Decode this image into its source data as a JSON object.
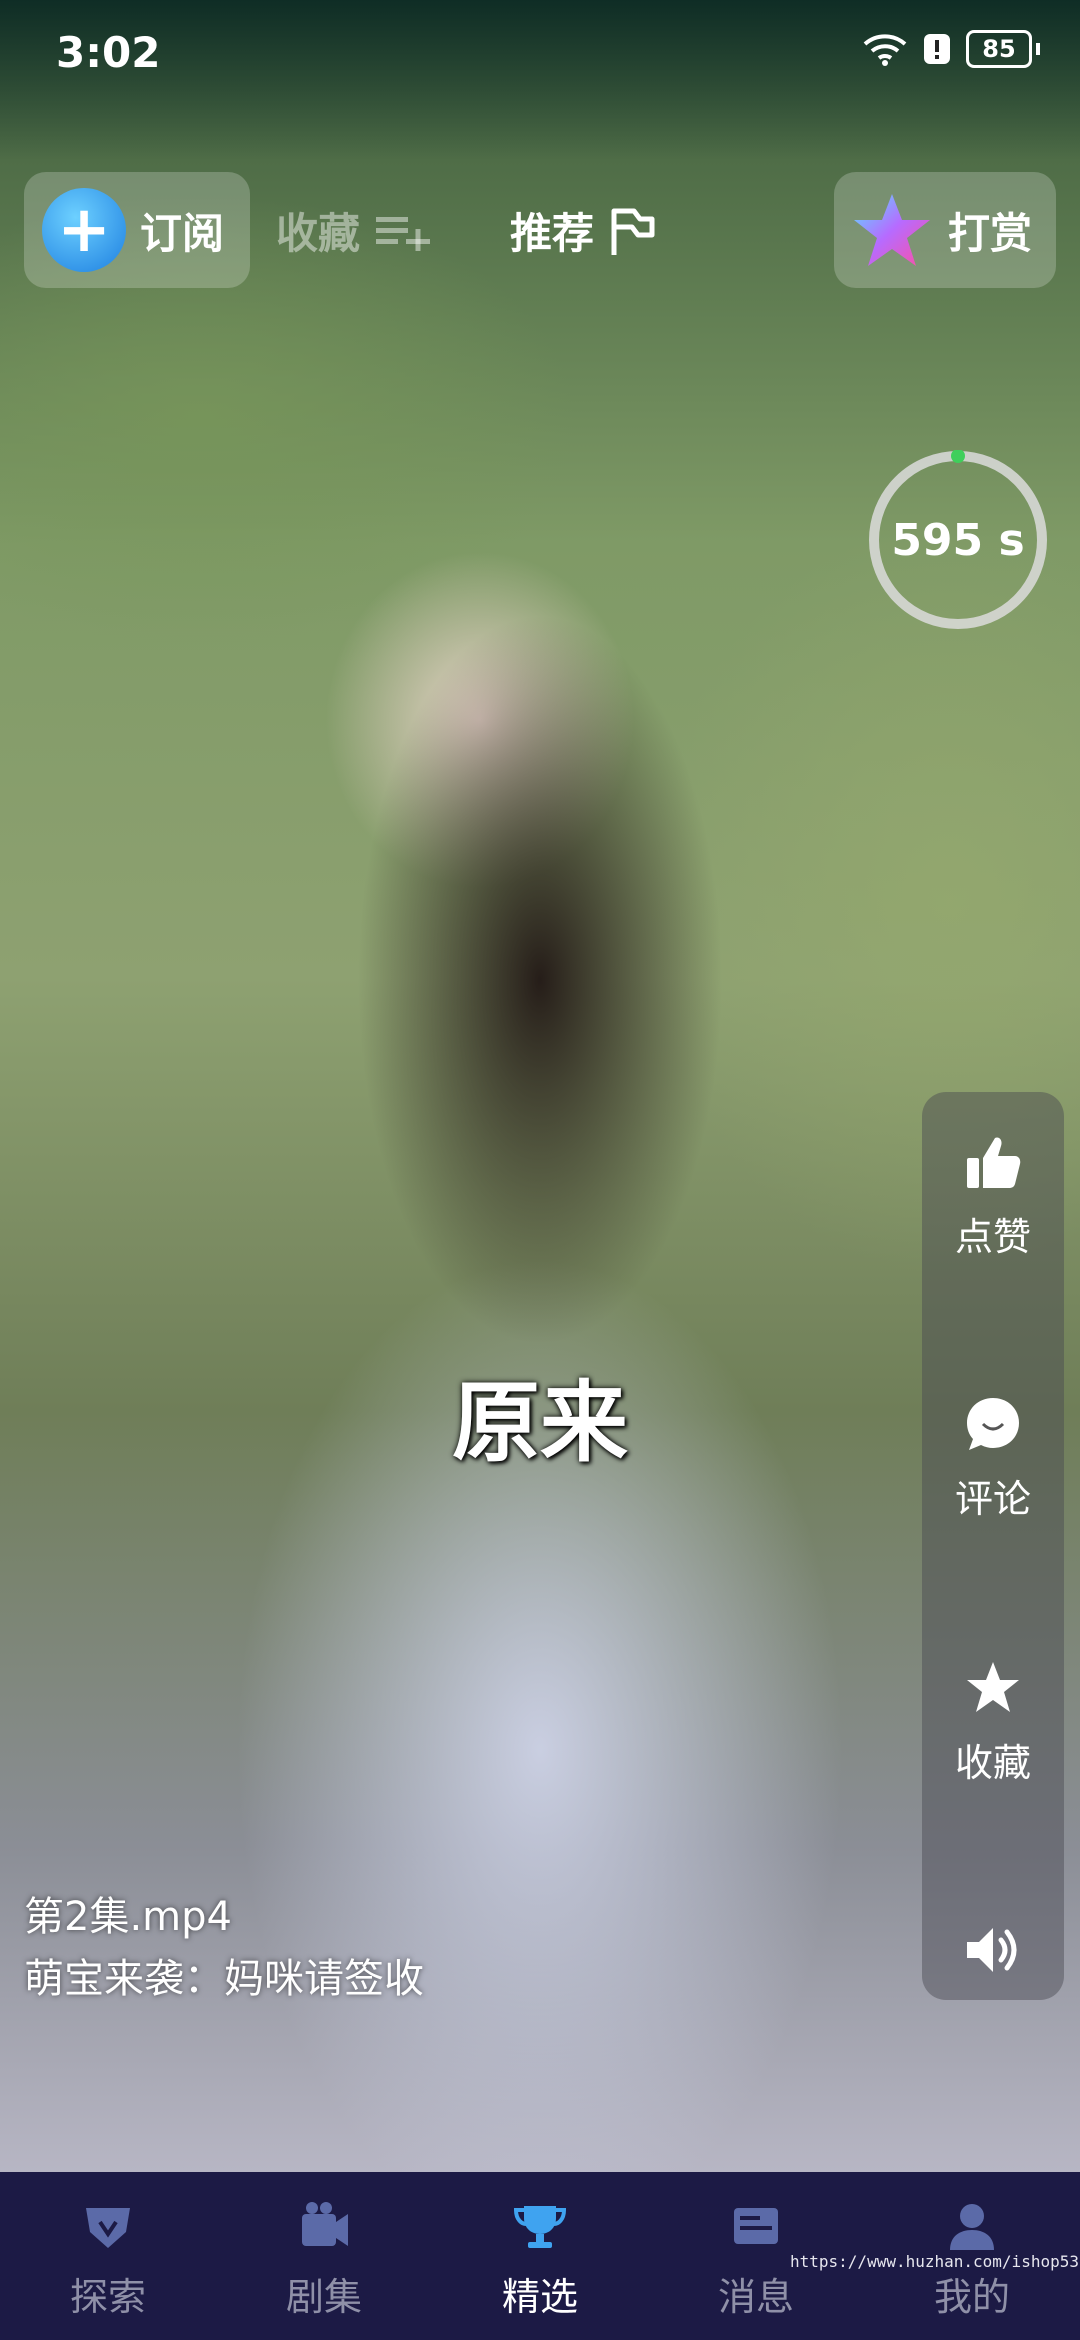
{
  "status_bar": {
    "time": "3:02",
    "battery": "85"
  },
  "top_bar": {
    "subscribe_label": "订阅",
    "favorite_label": "收藏",
    "recommend_label": "推荐",
    "reward_label": "打赏"
  },
  "timer": {
    "text": "595 s",
    "progress": 0.99
  },
  "subtitle": "原来",
  "video": {
    "episode": "第2集.mp4",
    "title": "萌宝来袭：妈咪请签收"
  },
  "actions": {
    "like_label": "点赞",
    "comment_label": "评论",
    "collect_label": "收藏"
  },
  "bottom_nav": {
    "items": [
      {
        "label": "探索",
        "icon": "explore-icon"
      },
      {
        "label": "剧集",
        "icon": "episodes-icon"
      },
      {
        "label": "精选",
        "icon": "featured-icon"
      },
      {
        "label": "消息",
        "icon": "message-icon"
      },
      {
        "label": "我的",
        "icon": "profile-icon"
      }
    ],
    "active_index": 2
  },
  "watermark": "https://www.huzhan.com/ishop53086",
  "colors": {
    "accent": "#1d7fe0",
    "nav_bg": "#1c1a45",
    "timer_progress": "#3fcf5b"
  }
}
